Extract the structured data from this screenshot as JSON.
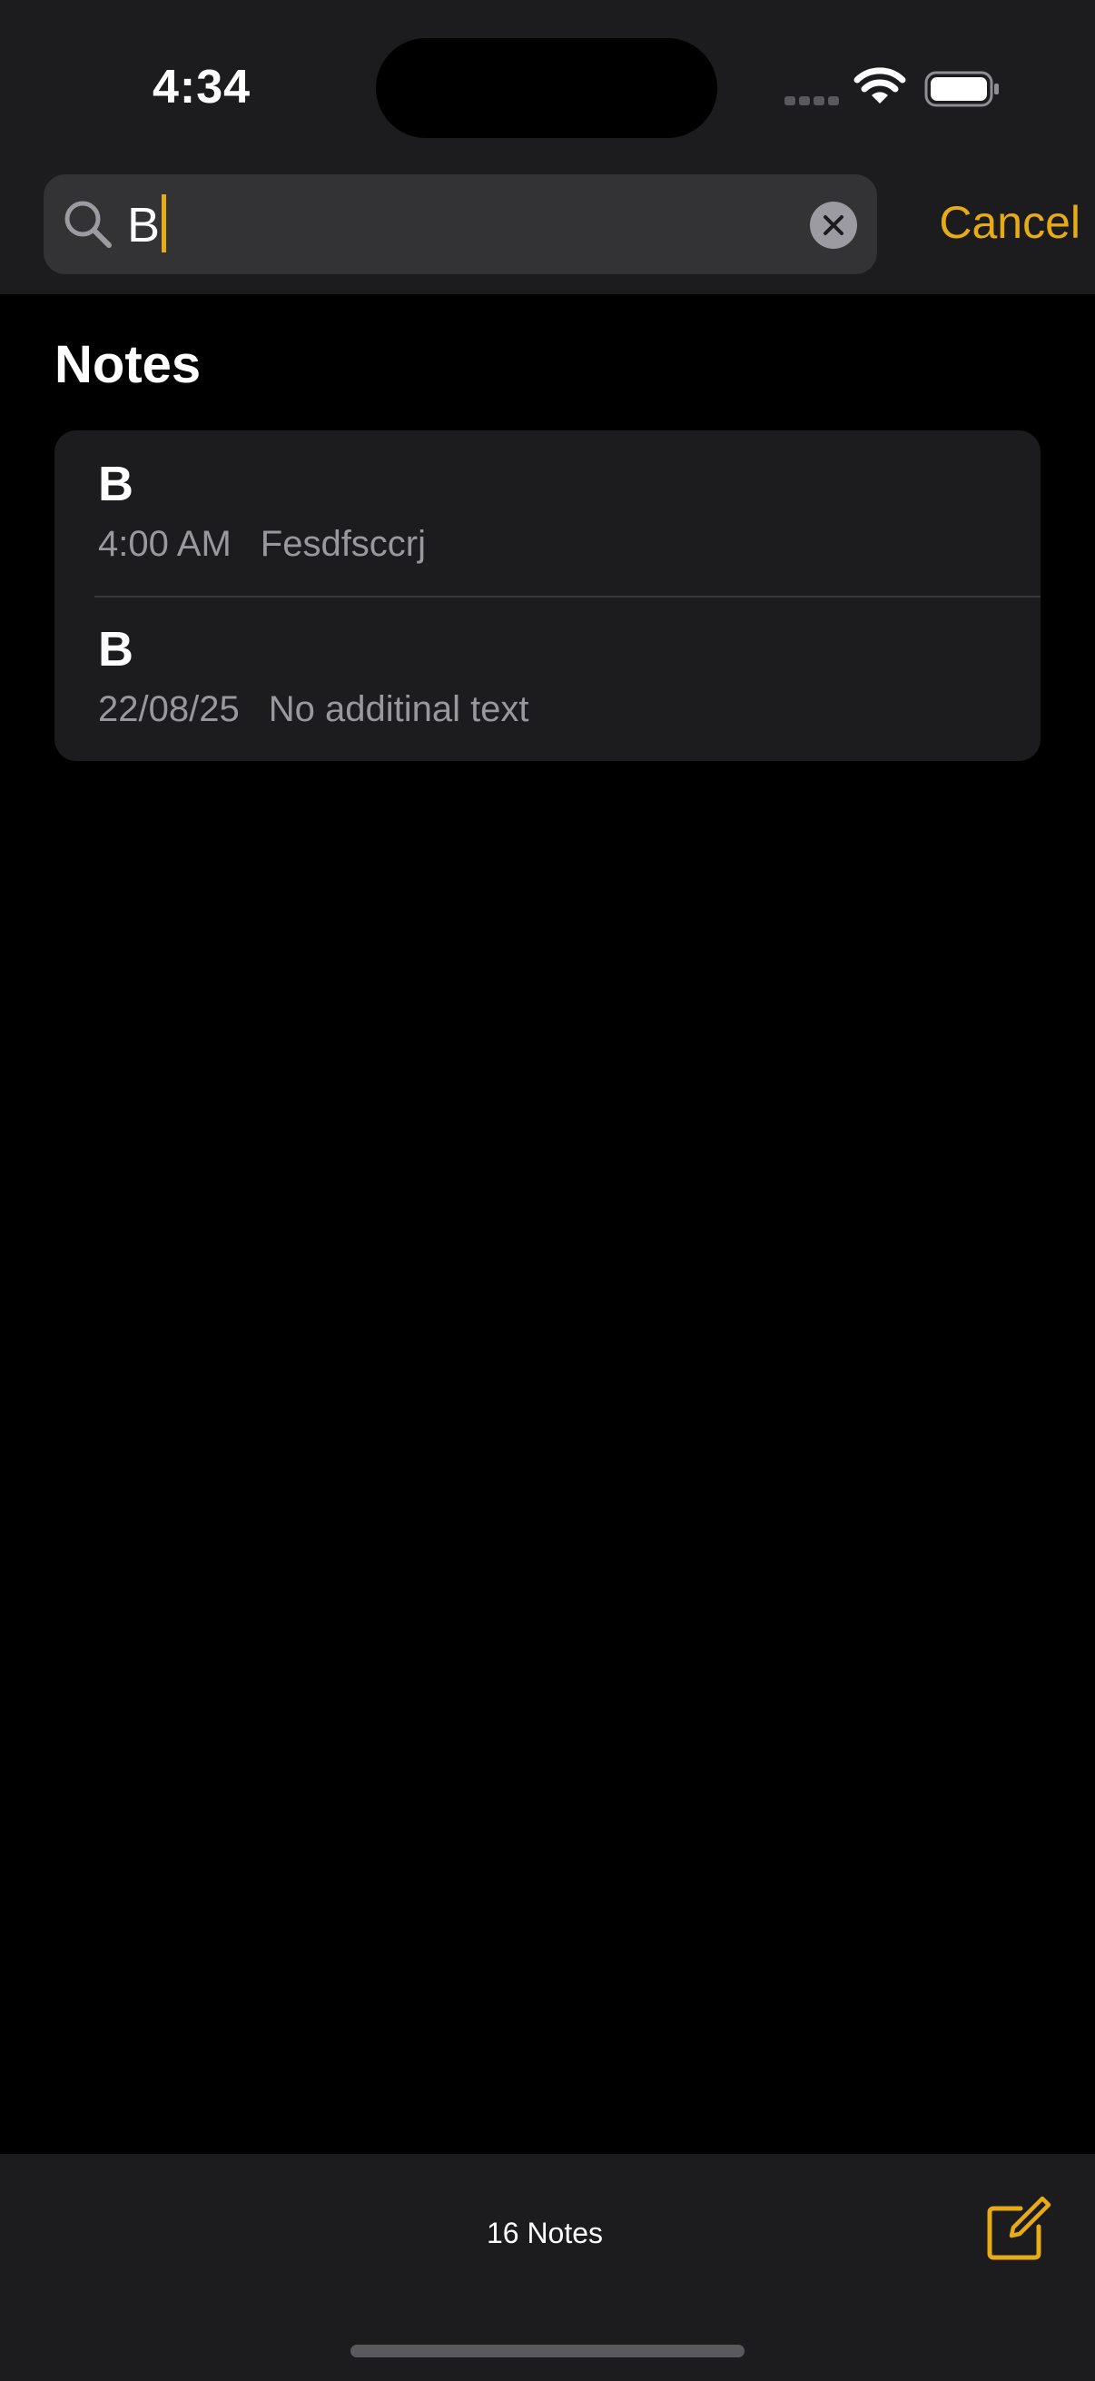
{
  "status_bar": {
    "time": "4:34",
    "icons": [
      "signal-icon",
      "wifi-icon",
      "battery-icon"
    ]
  },
  "search": {
    "query": "B",
    "clear_icon": "clear-icon",
    "search_icon": "magnifying-glass-icon",
    "cancel_label": "Cancel"
  },
  "results": {
    "section_title": "Notes",
    "notes": [
      {
        "title": "B",
        "date": "4:00 AM",
        "preview": "Fesdfsccrj"
      },
      {
        "title": "B",
        "date": "22/08/25",
        "preview": "No additinal text"
      }
    ]
  },
  "toolbar": {
    "count_label": "16 Notes",
    "compose_icon": "compose-icon"
  },
  "colors": {
    "accent": "#e6ab16",
    "background": "#000000",
    "surface": "#1c1c1e",
    "search_field": "#333336",
    "secondary_text": "#98989d"
  }
}
